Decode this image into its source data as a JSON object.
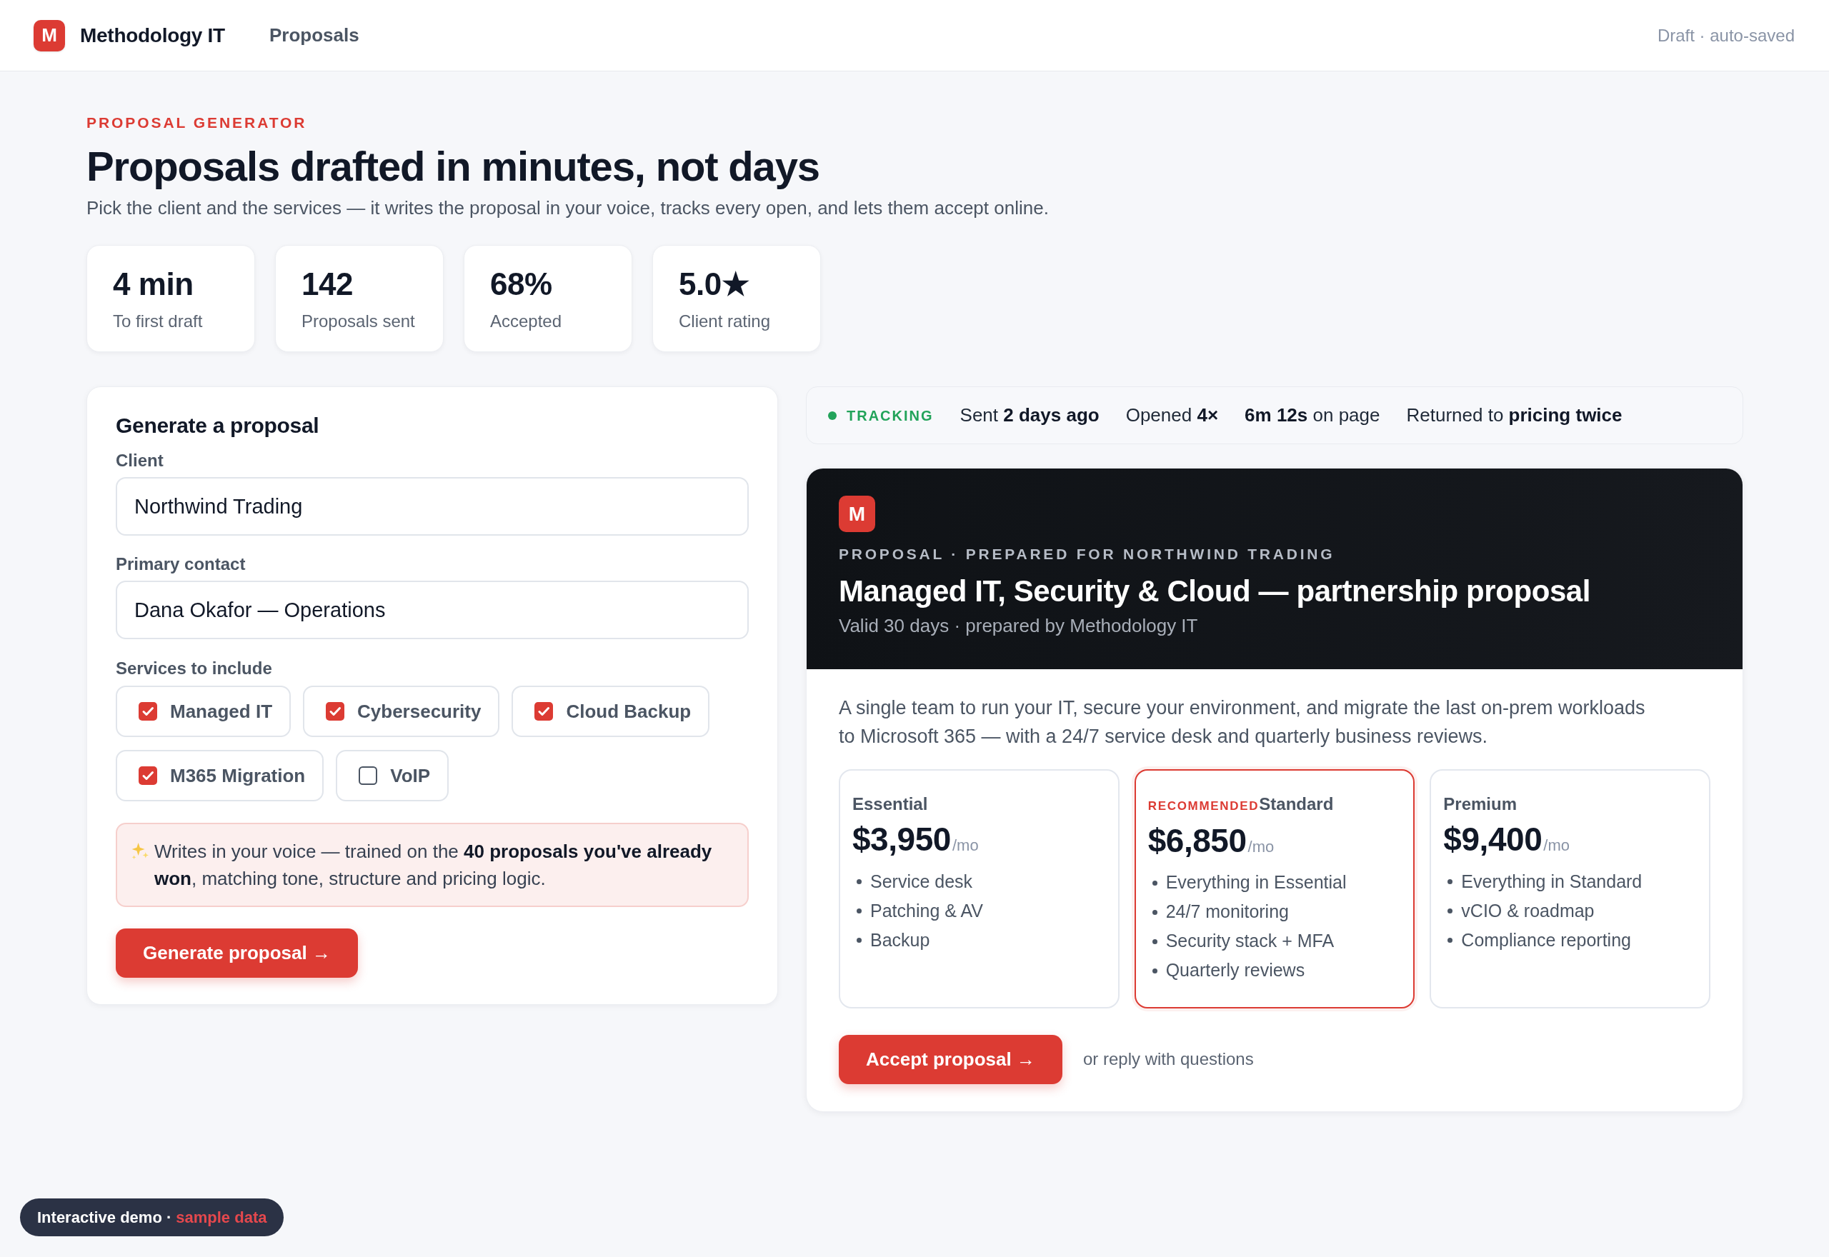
{
  "topbar": {
    "logo_letter": "M",
    "brand": "Methodology IT",
    "nav": [
      {
        "label": "Proposals"
      }
    ],
    "status": "Draft · auto-saved"
  },
  "hero": {
    "eyebrow": "PROPOSAL GENERATOR",
    "title": "Proposals drafted in minutes, not days",
    "subtitle": "Pick the client and the services — it writes the proposal in your voice, tracks every open, and lets them accept online."
  },
  "stats": [
    {
      "value": "4 min",
      "label": "To first draft"
    },
    {
      "value": "142",
      "label": "Proposals sent"
    },
    {
      "value": "68%",
      "label": "Accepted"
    },
    {
      "value": "5.0★",
      "label": "Client rating"
    }
  ],
  "generator": {
    "title": "Generate a proposal",
    "fields": [
      {
        "label": "Client",
        "value": "Northwind Trading"
      },
      {
        "label": "Primary contact",
        "value": "Dana Okafor — Operations"
      }
    ],
    "services_label": "Services to include",
    "services": [
      {
        "label": "Managed IT",
        "checked": true
      },
      {
        "label": "Cybersecurity",
        "checked": true
      },
      {
        "label": "Cloud Backup",
        "checked": true
      },
      {
        "label": "M365 Migration",
        "checked": true
      },
      {
        "label": "VoIP",
        "checked": false
      }
    ],
    "note": "Writes in your voice — trained on the **40 proposals you've already won**, matching tone, structure and pricing logic.",
    "button": "Generate proposal →"
  },
  "tracking": {
    "label": "TRACKING",
    "items": [
      "Sent **2 days ago**",
      "Opened **4×**",
      "**6m 12s** on page",
      "Returned to **pricing twice**"
    ]
  },
  "proposal": {
    "logo_letter": "M",
    "eyebrow": "PROPOSAL · PREPARED FOR NORTHWIND TRADING",
    "title": "Managed IT, Security & Cloud — partnership proposal",
    "subtitle": "Valid 30 days · prepared by Methodology IT",
    "summary": "A single team to run your IT, secure your environment, and migrate the last on-prem workloads to Microsoft 365 — with a 24/7 service desk and quarterly business reviews.",
    "tiers": [
      {
        "name": "Essential",
        "price": "$3,950",
        "period": "/mo",
        "recommended": false,
        "features": [
          "Service desk",
          "Patching & AV",
          "Backup"
        ]
      },
      {
        "badge": "RECOMMENDED",
        "name": "Standard",
        "price": "$6,850",
        "period": "/mo",
        "recommended": true,
        "features": [
          "Everything in Essential",
          "24/7 monitoring",
          "Security stack + MFA",
          "Quarterly reviews"
        ]
      },
      {
        "name": "Premium",
        "price": "$9,400",
        "period": "/mo",
        "recommended": false,
        "features": [
          "Everything in Standard",
          "vCIO & roadmap",
          "Compliance reporting"
        ]
      }
    ],
    "accept_button": "Accept proposal →",
    "reply_note": "or reply with questions"
  },
  "demo_banner": {
    "label": "Interactive demo ·",
    "highlight": "sample data"
  }
}
